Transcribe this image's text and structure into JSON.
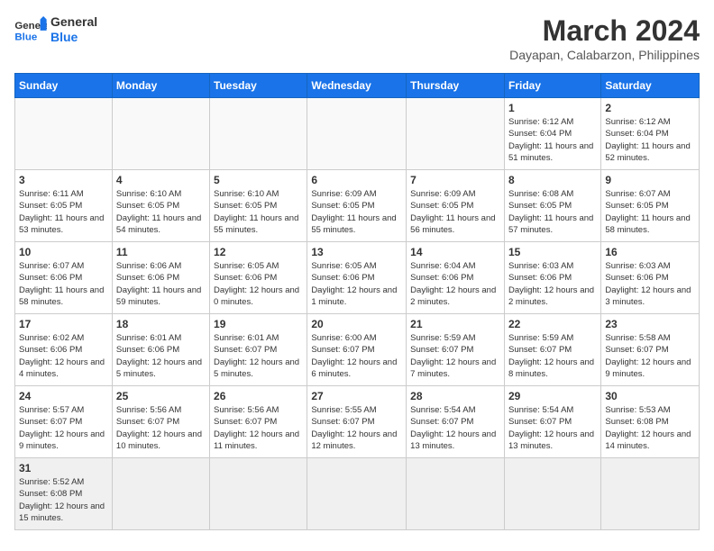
{
  "header": {
    "logo_general": "General",
    "logo_blue": "Blue",
    "month_title": "March 2024",
    "subtitle": "Dayapan, Calabarzon, Philippines"
  },
  "weekdays": [
    "Sunday",
    "Monday",
    "Tuesday",
    "Wednesday",
    "Thursday",
    "Friday",
    "Saturday"
  ],
  "weeks": [
    [
      {
        "day": "",
        "info": ""
      },
      {
        "day": "",
        "info": ""
      },
      {
        "day": "",
        "info": ""
      },
      {
        "day": "",
        "info": ""
      },
      {
        "day": "",
        "info": ""
      },
      {
        "day": "1",
        "info": "Sunrise: 6:12 AM\nSunset: 6:04 PM\nDaylight: 11 hours and 51 minutes."
      },
      {
        "day": "2",
        "info": "Sunrise: 6:12 AM\nSunset: 6:04 PM\nDaylight: 11 hours and 52 minutes."
      }
    ],
    [
      {
        "day": "3",
        "info": "Sunrise: 6:11 AM\nSunset: 6:05 PM\nDaylight: 11 hours and 53 minutes."
      },
      {
        "day": "4",
        "info": "Sunrise: 6:10 AM\nSunset: 6:05 PM\nDaylight: 11 hours and 54 minutes."
      },
      {
        "day": "5",
        "info": "Sunrise: 6:10 AM\nSunset: 6:05 PM\nDaylight: 11 hours and 55 minutes."
      },
      {
        "day": "6",
        "info": "Sunrise: 6:09 AM\nSunset: 6:05 PM\nDaylight: 11 hours and 55 minutes."
      },
      {
        "day": "7",
        "info": "Sunrise: 6:09 AM\nSunset: 6:05 PM\nDaylight: 11 hours and 56 minutes."
      },
      {
        "day": "8",
        "info": "Sunrise: 6:08 AM\nSunset: 6:05 PM\nDaylight: 11 hours and 57 minutes."
      },
      {
        "day": "9",
        "info": "Sunrise: 6:07 AM\nSunset: 6:05 PM\nDaylight: 11 hours and 58 minutes."
      }
    ],
    [
      {
        "day": "10",
        "info": "Sunrise: 6:07 AM\nSunset: 6:06 PM\nDaylight: 11 hours and 58 minutes."
      },
      {
        "day": "11",
        "info": "Sunrise: 6:06 AM\nSunset: 6:06 PM\nDaylight: 11 hours and 59 minutes."
      },
      {
        "day": "12",
        "info": "Sunrise: 6:05 AM\nSunset: 6:06 PM\nDaylight: 12 hours and 0 minutes."
      },
      {
        "day": "13",
        "info": "Sunrise: 6:05 AM\nSunset: 6:06 PM\nDaylight: 12 hours and 1 minute."
      },
      {
        "day": "14",
        "info": "Sunrise: 6:04 AM\nSunset: 6:06 PM\nDaylight: 12 hours and 2 minutes."
      },
      {
        "day": "15",
        "info": "Sunrise: 6:03 AM\nSunset: 6:06 PM\nDaylight: 12 hours and 2 minutes."
      },
      {
        "day": "16",
        "info": "Sunrise: 6:03 AM\nSunset: 6:06 PM\nDaylight: 12 hours and 3 minutes."
      }
    ],
    [
      {
        "day": "17",
        "info": "Sunrise: 6:02 AM\nSunset: 6:06 PM\nDaylight: 12 hours and 4 minutes."
      },
      {
        "day": "18",
        "info": "Sunrise: 6:01 AM\nSunset: 6:06 PM\nDaylight: 12 hours and 5 minutes."
      },
      {
        "day": "19",
        "info": "Sunrise: 6:01 AM\nSunset: 6:07 PM\nDaylight: 12 hours and 5 minutes."
      },
      {
        "day": "20",
        "info": "Sunrise: 6:00 AM\nSunset: 6:07 PM\nDaylight: 12 hours and 6 minutes."
      },
      {
        "day": "21",
        "info": "Sunrise: 5:59 AM\nSunset: 6:07 PM\nDaylight: 12 hours and 7 minutes."
      },
      {
        "day": "22",
        "info": "Sunrise: 5:59 AM\nSunset: 6:07 PM\nDaylight: 12 hours and 8 minutes."
      },
      {
        "day": "23",
        "info": "Sunrise: 5:58 AM\nSunset: 6:07 PM\nDaylight: 12 hours and 9 minutes."
      }
    ],
    [
      {
        "day": "24",
        "info": "Sunrise: 5:57 AM\nSunset: 6:07 PM\nDaylight: 12 hours and 9 minutes."
      },
      {
        "day": "25",
        "info": "Sunrise: 5:56 AM\nSunset: 6:07 PM\nDaylight: 12 hours and 10 minutes."
      },
      {
        "day": "26",
        "info": "Sunrise: 5:56 AM\nSunset: 6:07 PM\nDaylight: 12 hours and 11 minutes."
      },
      {
        "day": "27",
        "info": "Sunrise: 5:55 AM\nSunset: 6:07 PM\nDaylight: 12 hours and 12 minutes."
      },
      {
        "day": "28",
        "info": "Sunrise: 5:54 AM\nSunset: 6:07 PM\nDaylight: 12 hours and 13 minutes."
      },
      {
        "day": "29",
        "info": "Sunrise: 5:54 AM\nSunset: 6:07 PM\nDaylight: 12 hours and 13 minutes."
      },
      {
        "day": "30",
        "info": "Sunrise: 5:53 AM\nSunset: 6:08 PM\nDaylight: 12 hours and 14 minutes."
      }
    ],
    [
      {
        "day": "31",
        "info": "Sunrise: 5:52 AM\nSunset: 6:08 PM\nDaylight: 12 hours and 15 minutes."
      },
      {
        "day": "",
        "info": ""
      },
      {
        "day": "",
        "info": ""
      },
      {
        "day": "",
        "info": ""
      },
      {
        "day": "",
        "info": ""
      },
      {
        "day": "",
        "info": ""
      },
      {
        "day": "",
        "info": ""
      }
    ]
  ]
}
